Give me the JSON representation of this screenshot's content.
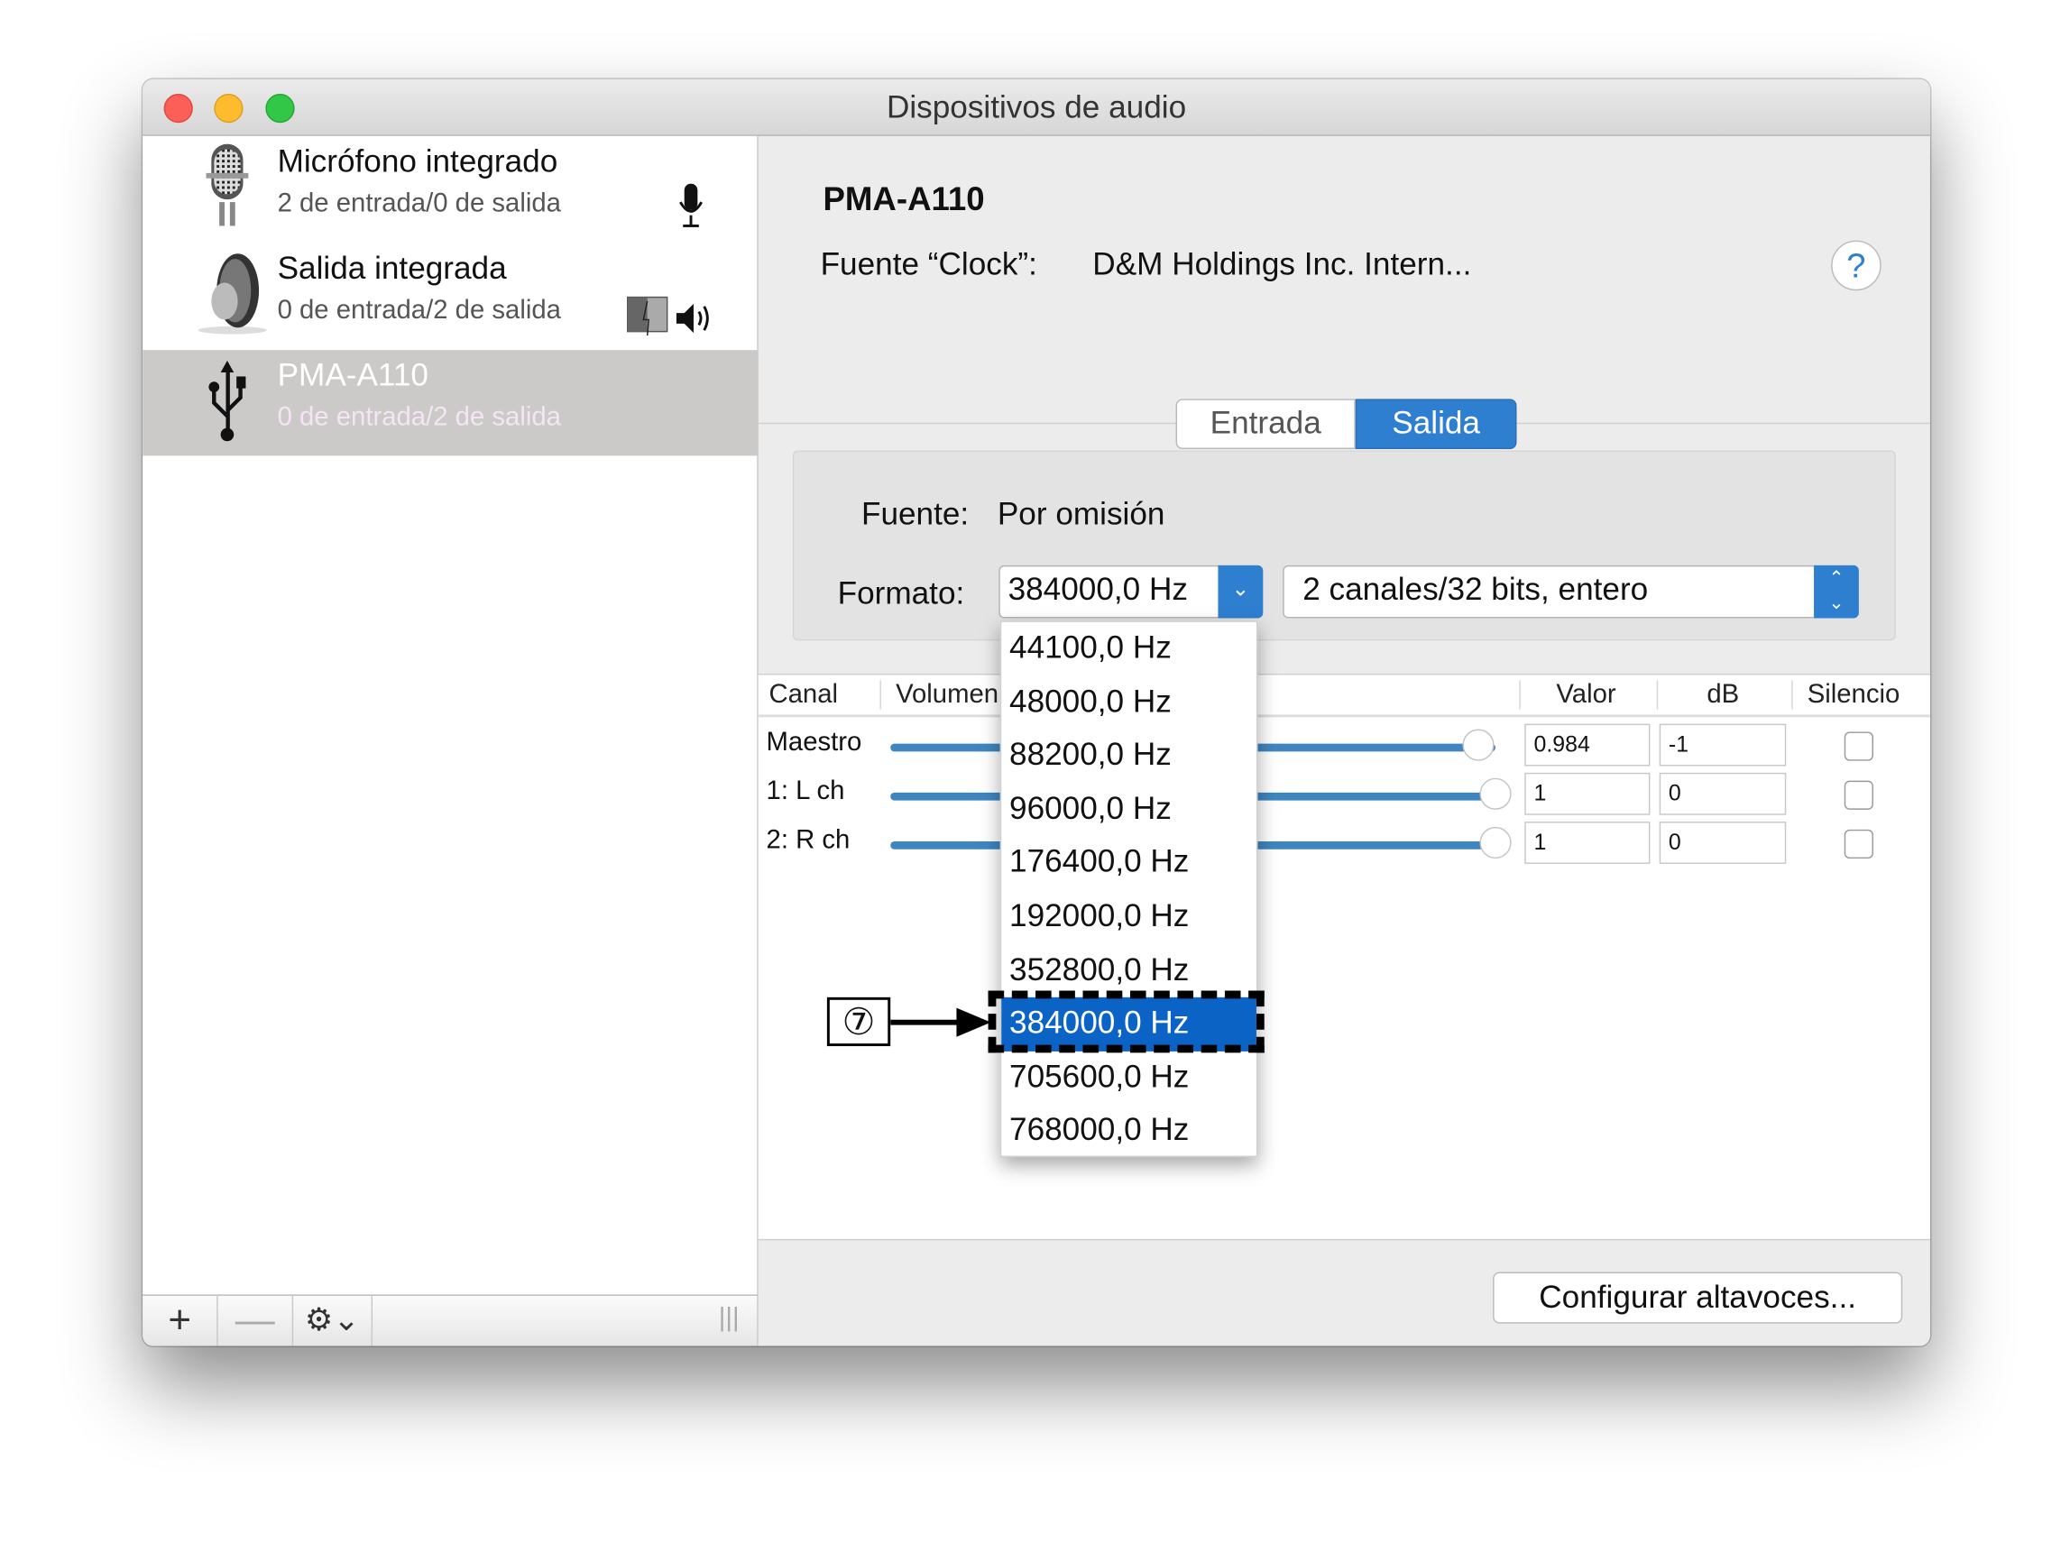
{
  "window": {
    "title": "Dispositivos de audio"
  },
  "sidebar": {
    "devices": [
      {
        "name": "Micrófono integrado",
        "channels": "2 de entrada/0 de salida",
        "icon": "microphone-icon"
      },
      {
        "name": "Salida integrada",
        "channels": "0 de entrada/2 de salida",
        "icon": "speaker-icon"
      },
      {
        "name": "PMA-A110",
        "channels": "0 de entrada/2 de salida",
        "icon": "usb-icon",
        "selected": true
      }
    ],
    "toolbar": {
      "add": "+",
      "remove": "—",
      "gear": "⚙⌄",
      "resize": "|||"
    }
  },
  "main": {
    "device_name": "PMA-A110",
    "clock_label": "Fuente “Clock”:",
    "clock_value": "D&M Holdings Inc. Intern...",
    "help": "?",
    "tabs": [
      {
        "label": "Entrada"
      },
      {
        "label": "Salida",
        "active": true
      }
    ],
    "source_label": "Fuente:",
    "source_value": "Por omisión",
    "format_label": "Formato:",
    "format_rate": "384000,0 Hz",
    "format_bits": "2 canales/32 bits, entero",
    "table": {
      "headers": [
        "Canal",
        "Volumen",
        "Valor",
        "dB",
        "Silencio"
      ],
      "rows": [
        {
          "channel": "Maestro",
          "value": "0.984",
          "db": "-1",
          "level": 0.984,
          "mute": false
        },
        {
          "channel": "1: L ch",
          "value": "1",
          "db": "0",
          "level": 1,
          "mute": false
        },
        {
          "channel": "2: R ch",
          "value": "1",
          "db": "0",
          "level": 1,
          "mute": false
        }
      ]
    },
    "configure_button": "Configurar altavoces..."
  },
  "rate_menu": {
    "options": [
      "44100,0 Hz",
      "48000,0 Hz",
      "88200,0 Hz",
      "96000,0 Hz",
      "176400,0 Hz",
      "192000,0 Hz",
      "352800,0 Hz",
      "384000,0 Hz",
      "705600,0 Hz",
      "768000,0 Hz"
    ],
    "selected": "384000,0 Hz"
  },
  "annotation": {
    "label": "⑦"
  },
  "colors": {
    "accent": "#3f86c0",
    "selection": "#0b63c6",
    "tab_active": "#2f7fd0"
  }
}
